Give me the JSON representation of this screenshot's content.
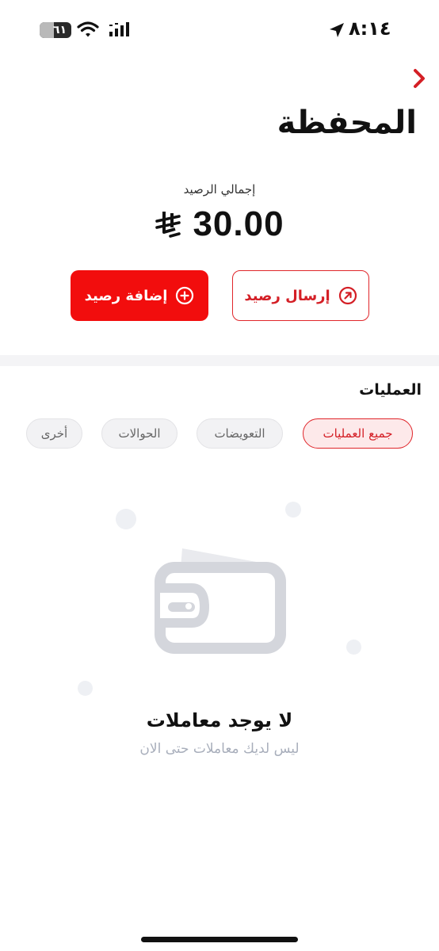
{
  "status_bar": {
    "time": "٨:١٤",
    "battery": "٦١"
  },
  "header": {
    "title": "المحفظة"
  },
  "balance": {
    "label": "إجمالي الرصيد",
    "amount": "30.00"
  },
  "actions": {
    "send_label": "إرسال رصيد",
    "add_label": "إضافة رصيد"
  },
  "transactions": {
    "title": "العمليات",
    "filters": [
      {
        "label": "جميع العمليات",
        "active": true
      },
      {
        "label": "التعويضات",
        "active": false
      },
      {
        "label": "الحوالات",
        "active": false
      },
      {
        "label": "أخرى",
        "active": false
      }
    ],
    "empty_title": "لا يوجد معاملات",
    "empty_subtitle": "ليس لديك معاملات حتى الان"
  },
  "colors": {
    "accent": "#f20d0d",
    "accent_border": "#e0262b",
    "muted_text": "#a8aebb",
    "chip_bg": "#f2f2f4"
  },
  "icons": {
    "back": "chevron-right-icon",
    "send": "arrow-up-right-circle-icon",
    "add": "plus-circle-icon",
    "currency": "saudi-riyal-icon",
    "empty": "wallet-icon"
  }
}
